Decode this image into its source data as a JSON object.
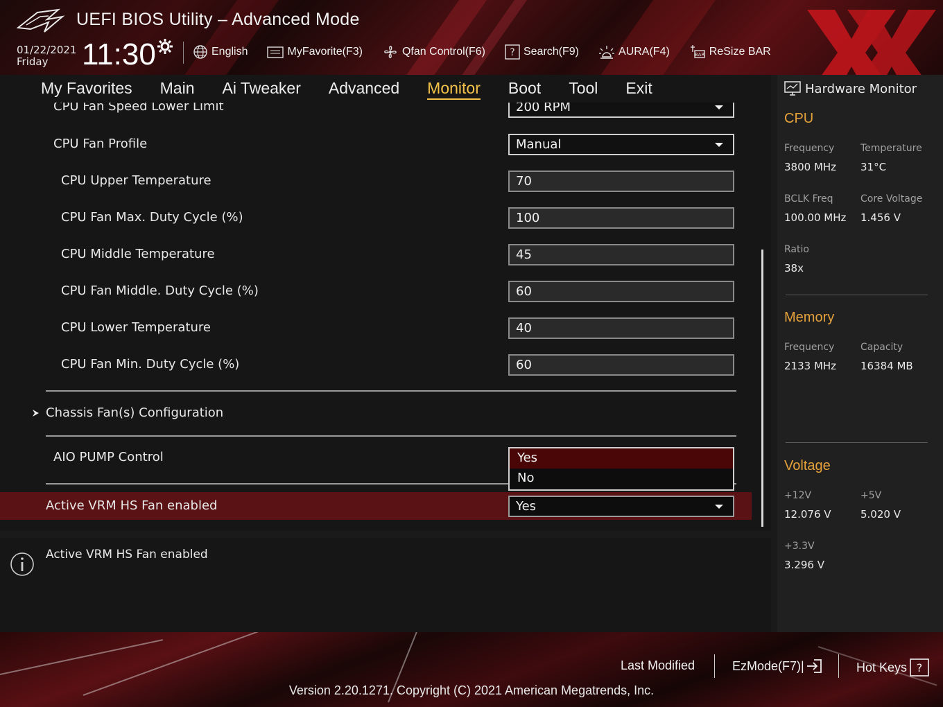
{
  "header": {
    "app_title": "UEFI BIOS Utility – Advanced Mode",
    "date": "01/22/2021",
    "weekday": "Friday",
    "time": "11:30",
    "toolbar": [
      {
        "label": "English",
        "icon": "globe-icon"
      },
      {
        "label": "MyFavorite(F3)",
        "icon": "favorite-list-icon"
      },
      {
        "label": "Qfan Control(F6)",
        "icon": "fan-icon"
      },
      {
        "label": "Search(F9)",
        "icon": "search-help-icon"
      },
      {
        "label": "AURA(F4)",
        "icon": "aura-light-icon"
      },
      {
        "label": "ReSize BAR",
        "icon": "resize-bar-icon"
      }
    ]
  },
  "nav": {
    "tabs": [
      "My Favorites",
      "Main",
      "Ai Tweaker",
      "Advanced",
      "Monitor",
      "Boot",
      "Tool",
      "Exit"
    ],
    "active": "Monitor"
  },
  "settings": {
    "cut_row": {
      "label": "CPU Fan Speed Lower Limit",
      "value": "200 RPM"
    },
    "cpu_fan_profile": {
      "label": "CPU Fan Profile",
      "value": "Manual"
    },
    "cpu_upper_temp": {
      "label": "CPU Upper Temperature",
      "value": "70"
    },
    "cpu_fan_max_duty": {
      "label": "CPU Fan Max. Duty Cycle (%)",
      "value": "100"
    },
    "cpu_middle_temp": {
      "label": "CPU Middle Temperature",
      "value": "45"
    },
    "cpu_fan_middle_duty": {
      "label": "CPU Fan Middle. Duty Cycle (%)",
      "value": "60"
    },
    "cpu_lower_temp": {
      "label": "CPU Lower Temperature",
      "value": "40"
    },
    "cpu_fan_min_duty": {
      "label": "CPU Fan Min. Duty Cycle (%)",
      "value": "60"
    },
    "chassis_fan_config": {
      "label": "Chassis Fan(s) Configuration"
    },
    "aio_pump": {
      "label": "AIO PUMP Control"
    },
    "active_vrm": {
      "label": "Active VRM HS Fan enabled",
      "value": "Yes"
    }
  },
  "dropdown": {
    "options": [
      "Yes",
      "No"
    ],
    "highlighted": "Yes"
  },
  "help": {
    "text": "Active VRM HS Fan enabled"
  },
  "hw_monitor": {
    "title": "Hardware Monitor",
    "cpu": {
      "heading": "CPU",
      "frequency_label": "Frequency",
      "frequency": "3800 MHz",
      "temperature_label": "Temperature",
      "temperature": "31°C",
      "bclk_label": "BCLK Freq",
      "bclk": "100.00 MHz",
      "core_voltage_label": "Core Voltage",
      "core_voltage": "1.456 V",
      "ratio_label": "Ratio",
      "ratio": "38x"
    },
    "memory": {
      "heading": "Memory",
      "frequency_label": "Frequency",
      "frequency": "2133 MHz",
      "capacity_label": "Capacity",
      "capacity": "16384 MB"
    },
    "voltage": {
      "heading": "Voltage",
      "v12_label": "+12V",
      "v12": "12.076 V",
      "v5_label": "+5V",
      "v5": "5.020 V",
      "v33_label": "+3.3V",
      "v33": "3.296 V"
    }
  },
  "footer": {
    "last_modified": "Last Modified",
    "ezmode": "EzMode(F7)|",
    "hot_keys": "Hot Keys",
    "version": "Version 2.20.1271. Copyright (C) 2021 American Megatrends, Inc."
  },
  "colors": {
    "accent": "#f5c34a",
    "section_heading": "#e6a23a",
    "selected_row": "#5a1214",
    "dropdown_highlight": "#4a0507"
  }
}
